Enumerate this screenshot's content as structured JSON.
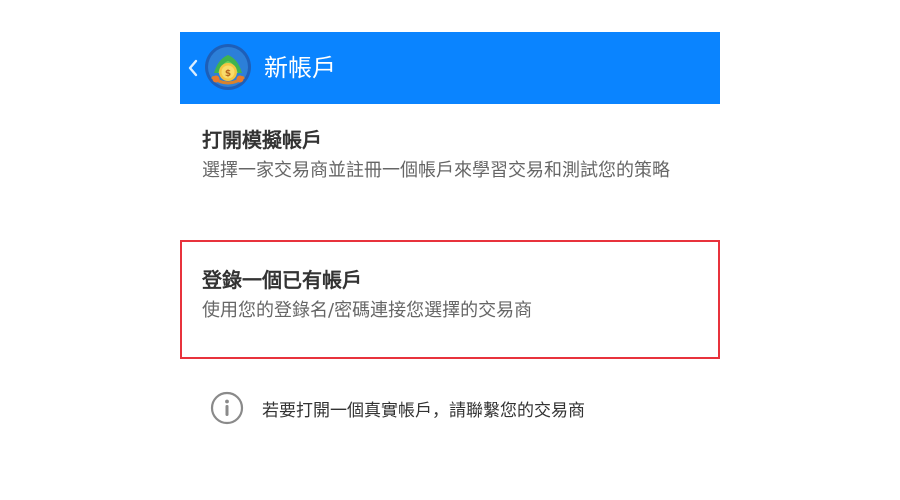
{
  "header": {
    "title": "新帳戶",
    "background_color": "#0a84ff",
    "back_icon": "chevron-left-icon",
    "logo_icon": "metatrader-logo-icon"
  },
  "options": [
    {
      "title": "打開模擬帳戶",
      "description": "選擇一家交易商並註冊一個帳戶來學習交易和測試您的策略"
    },
    {
      "title": "登錄一個已有帳戶",
      "description": "使用您的登錄名/密碼連接您選擇的交易商",
      "highlight_color": "#e8323c"
    }
  ],
  "info": {
    "icon": "info-icon",
    "text": "若要打開一個真實帳戶，請聯繫您的交易商"
  }
}
